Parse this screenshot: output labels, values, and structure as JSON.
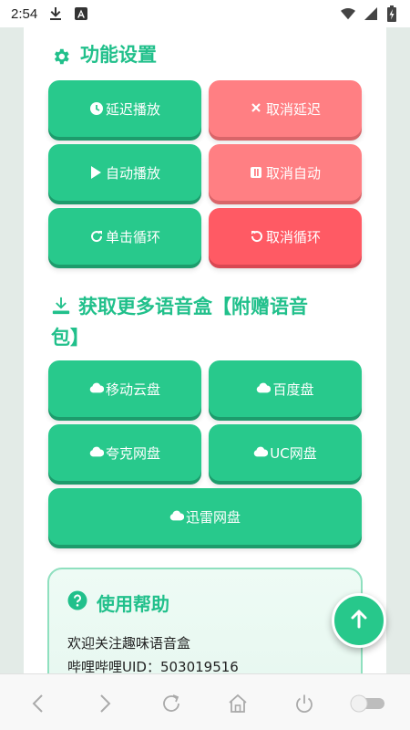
{
  "status_bar": {
    "time": "2:54",
    "icons": [
      "download-icon",
      "notification-a-icon",
      "wifi-icon",
      "signal-icon",
      "battery-charging-icon"
    ]
  },
  "settings": {
    "title": "功能设置",
    "buttons": [
      {
        "label": "延迟播放",
        "icon": "clock-icon"
      },
      {
        "label": "取消延迟",
        "icon": "close-icon"
      },
      {
        "label": "自动播放",
        "icon": "play-icon"
      },
      {
        "label": "取消自动",
        "icon": "pause-icon"
      },
      {
        "label": "单击循环",
        "icon": "refresh-icon"
      },
      {
        "label": "取消循环",
        "icon": "undo-icon"
      }
    ]
  },
  "downloads": {
    "title_line1": "获取更多语音盒【附赠语音",
    "title_line2": "包】",
    "buttons": [
      {
        "label": "移动云盘",
        "icon": "cloud-icon"
      },
      {
        "label": "百度盘",
        "icon": "cloud-icon"
      },
      {
        "label": "夸克网盘",
        "icon": "cloud-icon"
      },
      {
        "label": "UC网盘",
        "icon": "cloud-icon"
      },
      {
        "label": "迅雷网盘",
        "icon": "cloud-icon"
      }
    ]
  },
  "help": {
    "title": "使用帮助",
    "line1": "欢迎关注趣味语音盒",
    "line2": "哔哩哔哩UID：503019516"
  },
  "colors": {
    "accent_green": "#21c08b",
    "button_green": "#28c98c",
    "button_red": "#ff7f83",
    "button_red_strong": "#ff5a64"
  },
  "nav": [
    "back-icon",
    "forward-icon",
    "reload-icon",
    "home-icon",
    "power-icon",
    "toggle-switch"
  ]
}
